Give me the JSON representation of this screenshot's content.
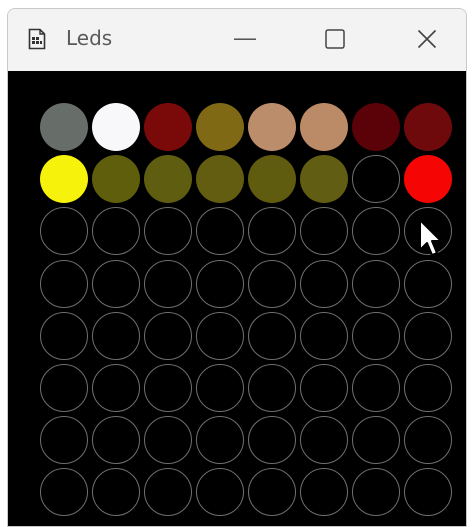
{
  "window": {
    "title": "Leds",
    "icon": "document-icon"
  },
  "controls": {
    "minimize_icon": "minimize-icon",
    "maximize_icon": "maximize-icon",
    "close_icon": "close-icon"
  },
  "grid": {
    "rows": 8,
    "cols": 8,
    "off_border_color": "#6f6f6f",
    "leds": [
      [
        "#676d68",
        "#f8f7fa",
        "#7a0a0a",
        "#7f6914",
        "#bc8d6a",
        "#bb8a66",
        "#5a0208",
        "#6e0a0c"
      ],
      [
        "#f6f20b",
        "#5f5e0d",
        "#5f5d10",
        "#625d10",
        "#5f5b0f",
        "#615d12",
        null,
        "#f60505"
      ],
      [
        null,
        null,
        null,
        null,
        null,
        null,
        null,
        null
      ],
      [
        null,
        null,
        null,
        null,
        null,
        null,
        null,
        null
      ],
      [
        null,
        null,
        null,
        null,
        null,
        null,
        null,
        null
      ],
      [
        null,
        null,
        null,
        null,
        null,
        null,
        null,
        null
      ],
      [
        null,
        null,
        null,
        null,
        null,
        null,
        null,
        null
      ],
      [
        null,
        null,
        null,
        null,
        null,
        null,
        null,
        null
      ]
    ]
  },
  "colors": {
    "titlebar": "#f3f3f3",
    "client_background": "#000000"
  }
}
